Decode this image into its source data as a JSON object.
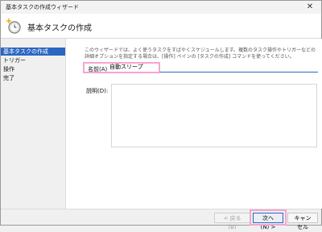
{
  "window": {
    "title": "基本タスクの作成ウィザード",
    "close_glyph": "✕"
  },
  "header": {
    "icon": "clock-sparkle-icon",
    "title": "基本タスクの作成"
  },
  "steps": [
    {
      "label": "基本タスクの作成",
      "active": true
    },
    {
      "label": "トリガー",
      "active": false
    },
    {
      "label": "操作",
      "active": false
    },
    {
      "label": "完了",
      "active": false
    }
  ],
  "form": {
    "description_text": "このウィザードでは、よく使うタスクをすばやくスケジュールします。複数のタスク操作やトリガーなどの詳細オプションを指定する場合は、[操作] ペインの [タスクの作成] コマンドを使ってください。",
    "name_label": "名前(A):",
    "name_value": "自動スリープ",
    "desc_label": "説明(D):",
    "desc_value": ""
  },
  "buttons": {
    "back": "< 戻る(B)",
    "next": "次へ(N) >",
    "cancel": "キャンセル"
  },
  "colors": {
    "accent": "#2b66c1",
    "highlight": "#f4a6cf"
  }
}
